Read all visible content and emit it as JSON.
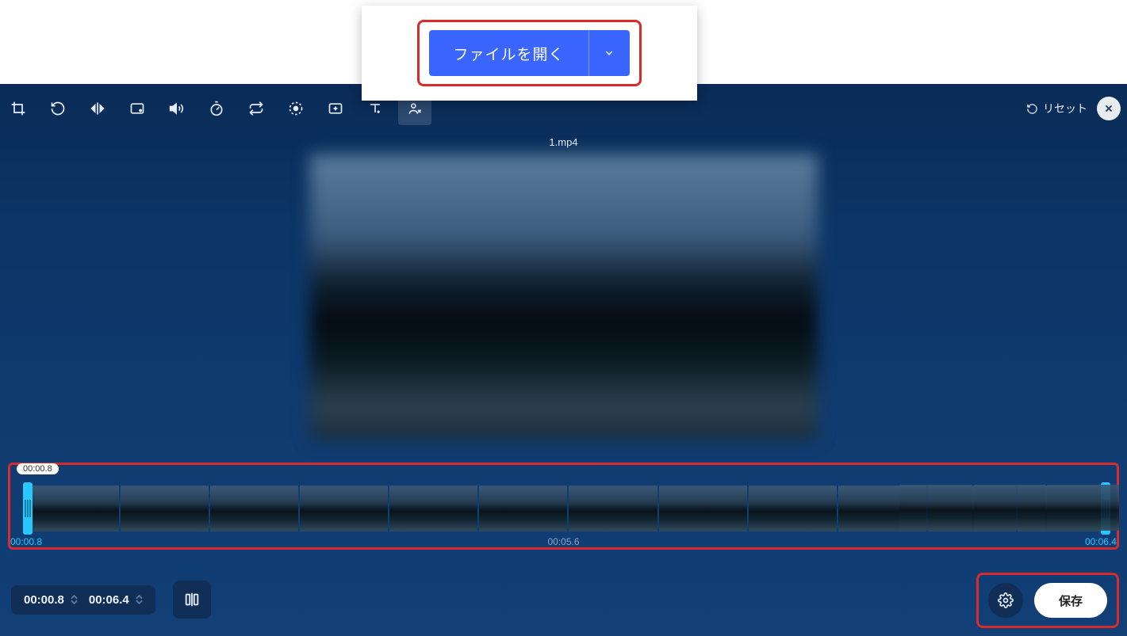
{
  "open_dialog": {
    "label": "ファイルを開く"
  },
  "file": {
    "name": "1.mp4"
  },
  "toolbar": {
    "reset_label": "リセット",
    "icons": [
      "crop-icon",
      "undo-icon",
      "flip-horizontal-icon",
      "aspect-ratio-icon",
      "volume-icon",
      "speed-icon",
      "loop-icon",
      "motion-icon",
      "enhance-icon",
      "text-icon",
      "person-remove-icon"
    ]
  },
  "timeline": {
    "current_badge": "00:00.8",
    "start": "00:00.8",
    "mid": "00:05.6",
    "end": "00:06.4"
  },
  "bottom": {
    "start_time": "00:00.8",
    "end_time": "00:06.4"
  },
  "save": {
    "label": "保存"
  },
  "colors": {
    "accent": "#3a66ff",
    "highlight": "#29c7ff",
    "danger": "#d82c2c"
  }
}
